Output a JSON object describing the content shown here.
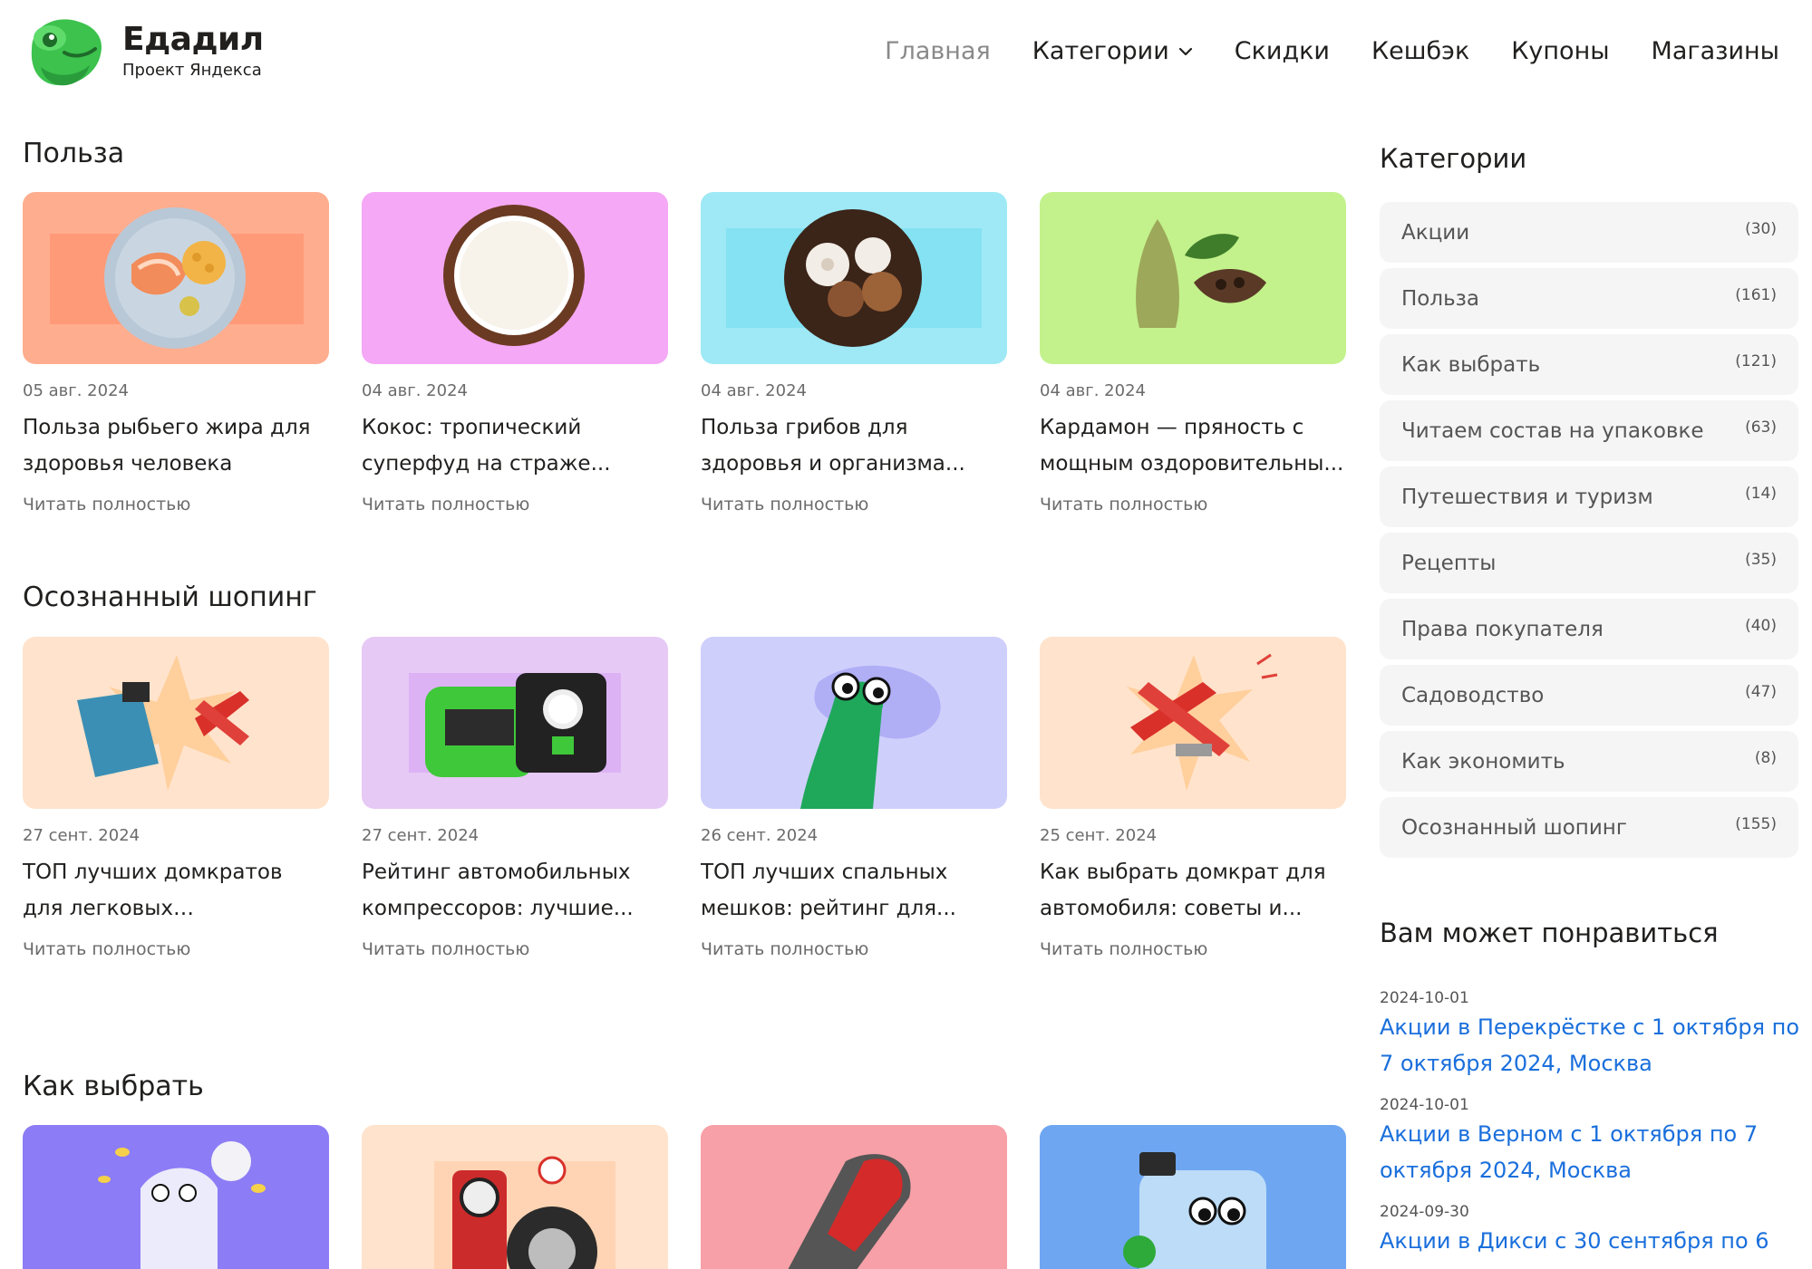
{
  "header": {
    "logo_title": "Едадил",
    "logo_sub": "Проект Яндекса",
    "nav": [
      {
        "label": "Главная"
      },
      {
        "label": "Категории"
      },
      {
        "label": "Скидки"
      },
      {
        "label": "Кешбэк"
      },
      {
        "label": "Купоны"
      },
      {
        "label": "Магазины"
      }
    ]
  },
  "sections": [
    {
      "title": "Польза",
      "cards": [
        {
          "date": "05 авг. 2024",
          "title": "Польза рыбьего жира для здоровья человека",
          "more": "Читать полностью",
          "bg": "#ffad8f",
          "image": "plate-fish-icon"
        },
        {
          "date": "04 авг. 2024",
          "title": "Кокос: тропический суперфуд на страже...",
          "more": "Читать полностью",
          "bg": "#f5a8f5",
          "image": "coconut-icon"
        },
        {
          "date": "04 авг. 2024",
          "title": "Польза грибов для здоровья и организма...",
          "more": "Читать полностью",
          "bg": "#9ee9f5",
          "image": "mushrooms-icon"
        },
        {
          "date": "04 авг. 2024",
          "title": "Кардамон — пряность с мощным оздоровительны...",
          "more": "Читать полностью",
          "bg": "#c3f28c",
          "image": "cardamom-icon"
        }
      ]
    },
    {
      "title": "Осознанный шопинг",
      "cards": [
        {
          "date": "27 сент. 2024",
          "title": "ТОП лучших домкратов для легковых автомобилей:...",
          "more": "Читать полностью",
          "bg": "#ffe3cc",
          "image": "car-jacks-icon"
        },
        {
          "date": "27 сент. 2024",
          "title": "Рейтинг автомобильных компрессоров: лучшие...",
          "more": "Читать полностью",
          "bg": "#e6c9f5",
          "image": "compressor-icon"
        },
        {
          "date": "26 сент. 2024",
          "title": "ТОП лучших спальных мешков: рейтинг для...",
          "more": "Читать полностью",
          "bg": "#cfcffc",
          "image": "sleeping-bag-icon"
        },
        {
          "date": "25 сент. 2024",
          "title": "Как выбрать домкрат для автомобиля: советы и...",
          "more": "Читать полностью",
          "bg": "#ffe3cc",
          "image": "car-jack-icon"
        }
      ]
    },
    {
      "title": "Как выбрать",
      "cards": [
        {
          "bg": "#8c7cf5",
          "image": "vitamins-jar-icon"
        },
        {
          "bg": "#ffe3cc",
          "image": "tire-inflator-icon"
        },
        {
          "bg": "#f7a0a7",
          "image": "sleeping-bag-icon"
        },
        {
          "bg": "#6ea6f2",
          "image": "washer-fluid-icon"
        }
      ]
    }
  ],
  "sidebar": {
    "categories_title": "Категории",
    "categories": [
      {
        "name": "Акции",
        "count": "(30)"
      },
      {
        "name": "Польза",
        "count": "(161)"
      },
      {
        "name": "Как выбрать",
        "count": "(121)"
      },
      {
        "name": "Читаем состав на упаковке",
        "count": "(63)"
      },
      {
        "name": "Путешествия и туризм",
        "count": "(14)"
      },
      {
        "name": "Рецепты",
        "count": "(35)"
      },
      {
        "name": "Права покупателя",
        "count": "(40)"
      },
      {
        "name": "Садоводство",
        "count": "(47)"
      },
      {
        "name": "Как экономить",
        "count": "(8)"
      },
      {
        "name": "Осознанный шопинг",
        "count": "(155)"
      }
    ],
    "recommend_title": "Вам может понравиться",
    "recommend": [
      {
        "date": "2024-10-01",
        "title": "Акции в Перекрёстке с 1 октября по 7 октября 2024, Москва"
      },
      {
        "date": "2024-10-01",
        "title": "Акции в Верном с 1 октября по 7 октября 2024, Москва"
      },
      {
        "date": "2024-09-30",
        "title": "Акции в Дикси с 30 сентября по 6"
      }
    ]
  },
  "colors": {
    "text": "#21201f",
    "muted": "#6b6b6b",
    "link": "#1a6fdc",
    "nav_active": "#8a8a8a",
    "category_bg": "#f5f5f6"
  }
}
